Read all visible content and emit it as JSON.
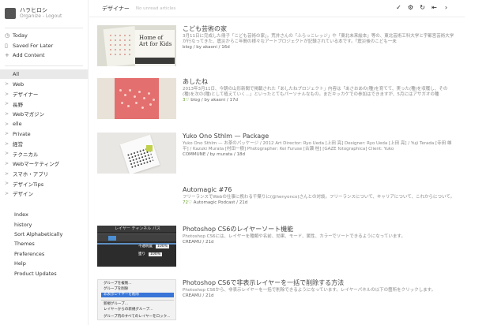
{
  "user": {
    "name": "ハラヒロシ",
    "links": "Organize - Logout"
  },
  "primary_nav": [
    {
      "label": "Today",
      "icon": "clock-icon",
      "glyph": "◷"
    },
    {
      "label": "Saved For Later",
      "icon": "bookmark-icon",
      "glyph": "▯"
    },
    {
      "label": "Add Content",
      "icon": "plus-icon",
      "glyph": "+"
    }
  ],
  "categories": [
    {
      "label": "All",
      "active": true
    },
    {
      "label": "Web"
    },
    {
      "label": "デザイナー"
    },
    {
      "label": "長野"
    },
    {
      "label": "Webマガジン"
    },
    {
      "label": "elle"
    },
    {
      "label": "Private"
    },
    {
      "label": "経営"
    },
    {
      "label": "テクニカル"
    },
    {
      "label": "Webマーケティング"
    },
    {
      "label": "スマホ・アプリ"
    },
    {
      "label": "デザインTips"
    },
    {
      "label": "デザイン"
    }
  ],
  "footer_links": [
    "Index",
    "history",
    "Sort Alphabetically",
    "Themes",
    "Preferences",
    "Help",
    "Product Updates"
  ],
  "header": {
    "title": "デザイナー",
    "subtitle": "No unread articles"
  },
  "toolbar": [
    {
      "name": "mark-read-icon",
      "glyph": "✓"
    },
    {
      "name": "settings-icon",
      "glyph": "⚙"
    },
    {
      "name": "refresh-icon",
      "glyph": "↻"
    },
    {
      "name": "collapse-icon",
      "glyph": "⇤"
    },
    {
      "name": "next-icon",
      "glyph": "›"
    }
  ],
  "articles": [
    {
      "title": "こども芸術の家",
      "summary": "3月11日に完成した冊子「こども芸術の家」。荒井さんの「ふらっこレッジ」や「東北未来絵本」等の、東北芸術工科大学と宇都宮芸術大学が行なってきた、震災からこ年間の様々なアートプロジェクトが記録されている本です。「震災後のこども一未",
      "pop": "",
      "meta": "blog / by akaoni / 16d"
    },
    {
      "title": "あしたね",
      "summary": "2013年3月11日、今朝の山形新聞で掲載された「あしたねプロジェクト」内容は「あさおあの(種)を育てて、実った(種)を収穫し、その(種)を次の(種)として植えていく...」といったとてもパーソナルなもの。まだキッカケでの参加はできますが、5月にはアサガオの種",
      "pop": "3",
      "meta": "blog / by akaoni / 17d"
    },
    {
      "title": "Yuko Ono Sthlm — Package",
      "summary": "Yuko Ono Sthlm — お茶のパッケージ / 2012 Art Director: Ryo Ueda [上田 亮] Designer: Ryo Ueda [上田 亮] / Yuji Terada [寺田 雄平] / Kazuki Murata [村田一樹] Photographer: Kei Furuse [古瀬 桂] [GAZE fotographica] Client: Yuko",
      "pop": "",
      "meta": "COMMUNE / by murata / 18d"
    },
    {
      "title": "Automagic #76",
      "summary": "フリーランスでWebの仕事に携わる千葉りに(@henyonco)さんとの対談。フリーランスについて、キャリアについて、これからについて。",
      "pop": "72",
      "meta": "Automagic Podcast / 21d"
    },
    {
      "title": "Photoshop CS6のレイヤーソート機能",
      "summary": "Photoshop CS6には、レイヤーを種類や名前、効果、モード、属性、カラーでソートできるようになっています。",
      "pop": "",
      "meta": "CREAMU / 21d"
    },
    {
      "title": "Photoshop CS6で非表示レイヤーを一括で削除する方法",
      "summary": "Photoshop CS6から、非表示レイヤーを一括で削除できるようになっています。レイヤーパネルの以下の箇所をクリックします。",
      "pop": "",
      "meta": "CREAMU / 21d"
    }
  ],
  "thumb_text": {
    "kids_cover": "Home of Art for Kids",
    "ps_menu": "レイヤー  チャンネル  パス",
    "ps_opacity_label": "不透明度",
    "ps_opacity_value": "100%",
    "ps_fill_label": "塗り",
    "ps_fill_value": "100%",
    "ps_context_menu": [
      "グループを複製...",
      "グループを削除",
      "非表示レイヤーを削除",
      "新規グループ...",
      "レイヤーからの新規グループ...",
      "グループ内のすべてのレイヤーをロック..."
    ]
  }
}
